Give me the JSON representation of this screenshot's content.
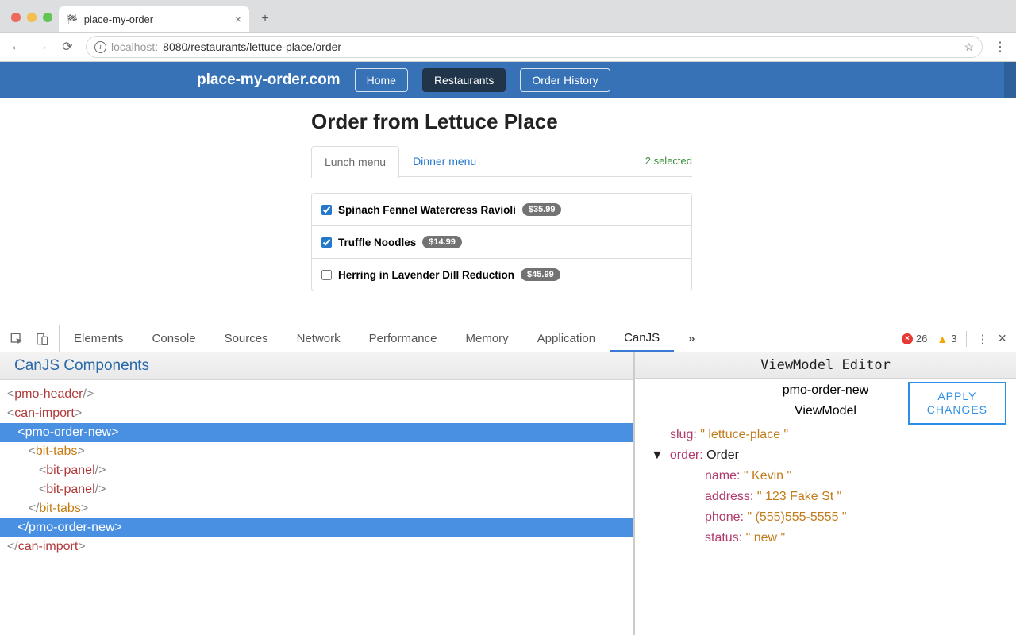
{
  "browser": {
    "tab_title": "place-my-order",
    "url_prefix": "localhost:",
    "url_rest": "8080/restaurants/lettuce-place/order"
  },
  "header": {
    "logo": "place-my-order.com",
    "home": "Home",
    "restaurants": "Restaurants",
    "order_history": "Order History"
  },
  "page": {
    "title": "Order from Lettuce Place",
    "tab_lunch": "Lunch menu",
    "tab_dinner": "Dinner menu",
    "selected_label": "2 selected",
    "items": [
      {
        "name": "Spinach Fennel Watercress Ravioli",
        "price": "$35.99",
        "checked": true
      },
      {
        "name": "Truffle Noodles",
        "price": "$14.99",
        "checked": true
      },
      {
        "name": "Herring in Lavender Dill Reduction",
        "price": "$45.99",
        "checked": false
      }
    ]
  },
  "devtools": {
    "tabs": [
      "Elements",
      "Console",
      "Sources",
      "Network",
      "Performance",
      "Memory",
      "Application",
      "CanJS"
    ],
    "active_tab": "CanJS",
    "errors": "26",
    "warnings": "3",
    "left_panel_title": "CanJS Components",
    "right_panel_title": "ViewModel Editor",
    "apply_button": "APPLY CHANGES",
    "vm_sub1": "pmo-order-new",
    "vm_sub2": "ViewModel",
    "vm": {
      "slug_key": "slug:",
      "slug_val": "\" lettuce-place \"",
      "order_key": "order:",
      "order_type": "Order",
      "name_key": "name:",
      "name_val": "\" Kevin \"",
      "address_key": "address:",
      "address_val": "\" 123 Fake St \"",
      "phone_key": "phone:",
      "phone_val": "\" (555)555-5555 \"",
      "status_key": "status:",
      "status_val": "\" new \""
    },
    "tree": {
      "n0": "pmo-header",
      "n1": "can-import",
      "n2": "pmo-order-new",
      "n3": "bit-tabs",
      "n4": "bit-panel",
      "n5": "bit-panel",
      "n6": "bit-tabs",
      "n7": "pmo-order-new",
      "n8": "can-import"
    }
  }
}
